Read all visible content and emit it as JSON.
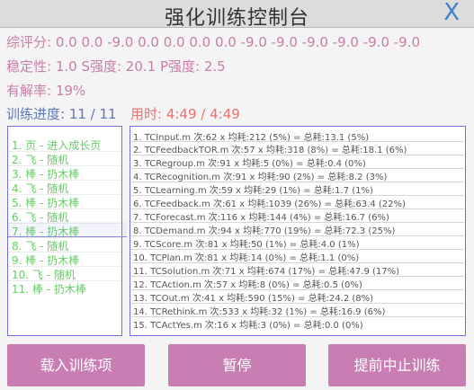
{
  "window": {
    "title": "强化训练控制台",
    "close_label": "X"
  },
  "stats": {
    "score": "综评分: 0.0 0.0 -9.0 0.0 0.0 0.0 0.0 -9.0 -9.0 -9.0 -9.0 -9.0 -9.0",
    "stability": "稳定性: 1.0  S强度: 20.1  P强度: 2.5",
    "solve_rate": "有解率: 19%",
    "progress": "训练进度: 11 / 11",
    "time": "用时: 4:49 / 4:49"
  },
  "train_items": [
    "1. 页 - 进入成长页",
    "2. 飞 - 随机",
    "3. 棒 - 扔木棒",
    "4. 飞 - 随机",
    "5. 棒 - 扔木棒",
    "6. 飞 - 随机",
    "7. 棒 - 扔木棒",
    "8. 飞 - 随机",
    "9. 棒 - 扔木棒",
    "10. 飞 - 随机",
    "11. 棒 - 扔木棒"
  ],
  "log_items": [
    "1. TCInput.m 次:62 x 均耗:212 (5%) = 总耗:13.1 (5%)",
    "2. TCFeedbackTOR.m 次:57 x 均耗:318 (8%) = 总耗:18.1 (6%)",
    "3. TCRegroup.m 次:91 x 均耗:5 (0%) = 总耗:0.4 (0%)",
    "4. TCRecognition.m 次:91 x 均耗:90 (2%) = 总耗:8.2 (3%)",
    "5. TCLearning.m 次:59 x 均耗:29 (1%) = 总耗:1.7 (1%)",
    "6. TCFeedback.m 次:61 x 均耗:1039 (26%) = 总耗:63.4 (22%)",
    "7. TCForecast.m 次:116 x 均耗:144 (4%) = 总耗:16.7 (6%)",
    "8. TCDemand.m 次:94 x 均耗:770 (19%) = 总耗:72.3 (25%)",
    "9. TCScore.m 次:81 x 均耗:50 (1%) = 总耗:4.0 (1%)",
    "10. TCPlan.m 次:81 x 均耗:14 (0%) = 总耗:1.1 (0%)",
    "11. TCSolution.m 次:71 x 均耗:674 (17%) = 总耗:47.9 (17%)",
    "12. TCAction.m 次:57 x 均耗:8 (0%) = 总耗:0.5 (0%)",
    "13. TCOut.m 次:41 x 均耗:590 (15%) = 总耗:24.2 (8%)",
    "14. TCRethink.m 次:533 x 均耗:32 (1%) = 总耗:16.9 (6%)",
    "15. TCActYes.m 次:16 x 均耗:3 (0%) = 总耗:0.0 (0%)"
  ],
  "buttons": {
    "load": "载入训练项",
    "pause": "暂停",
    "stop": "提前中止训练"
  },
  "colors": {
    "button": "#c97eb3",
    "panel_border": "#6f6fe0",
    "item_green": "#66cc66",
    "time_red": "#f07070"
  }
}
